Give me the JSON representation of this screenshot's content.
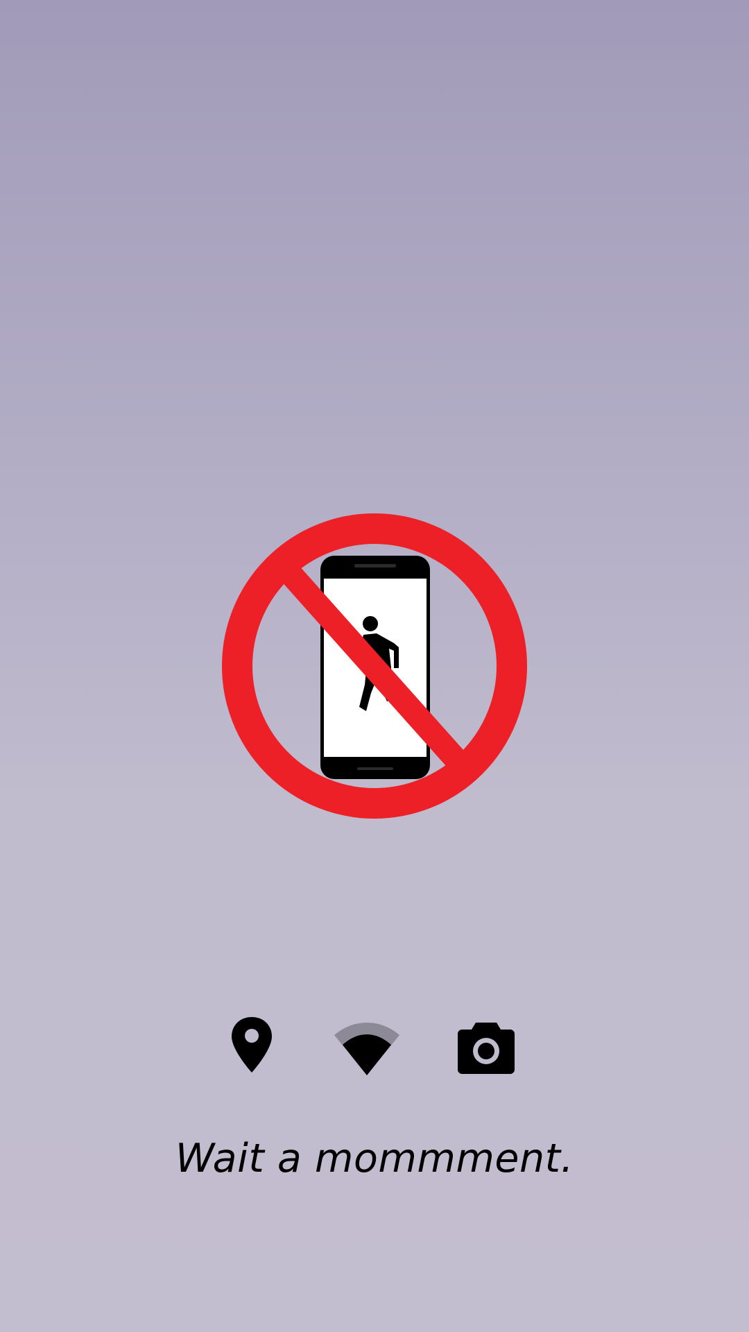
{
  "screen": {
    "background_top": "#a19bb9",
    "background_bottom": "#c2bdcf"
  },
  "hero": {
    "icon": "no-phone-while-walking-icon",
    "ring_color": "#ed1f27",
    "device_color": "#000000"
  },
  "status_icons": [
    {
      "icon": "location-pin-icon",
      "color": "#000000"
    },
    {
      "icon": "wifi-icon",
      "color": "#000000",
      "inactive_color": "#8d8a97"
    },
    {
      "icon": "camera-icon",
      "color": "#000000"
    }
  ],
  "message": {
    "text": "Wait a mommment."
  }
}
